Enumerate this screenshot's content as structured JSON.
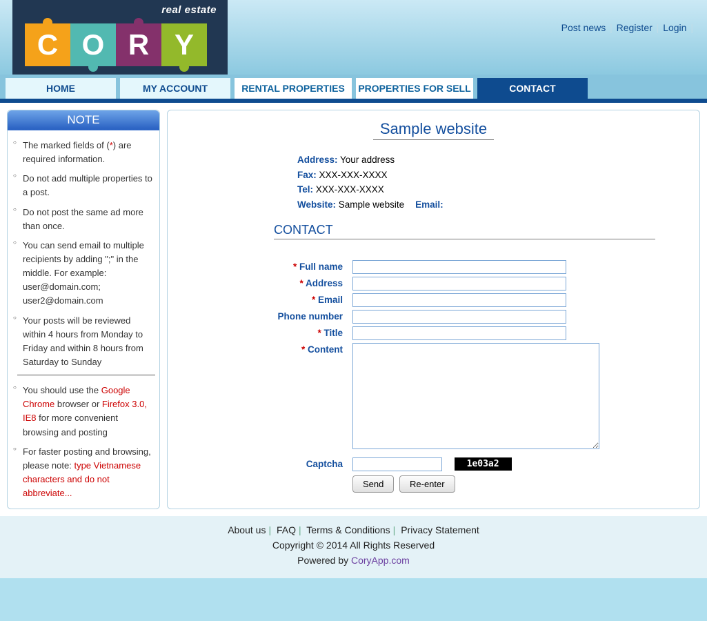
{
  "header": {
    "logo_top": "real estate",
    "logo_letters": [
      "C",
      "O",
      "R",
      "Y"
    ],
    "links": {
      "post": "Post news",
      "register": "Register",
      "login": "Login"
    }
  },
  "nav": {
    "items": [
      "HOME",
      "MY ACCOUNT",
      "RENTAL PROPERTIES",
      "PROPERTIES FOR SELL",
      "CONTACT"
    ]
  },
  "sidebar": {
    "title": "NOTE",
    "items": [
      {
        "pre": "The marked fields of (",
        "red": "*",
        "post": ") are required information."
      },
      {
        "text": "Do not add multiple properties to a post."
      },
      {
        "text": "Do not post the same ad more than once."
      },
      {
        "text": "You can send email to multiple recipients by adding \";\" in the middle. For example: user@domain.com; user2@domain.com"
      },
      {
        "text": "Your posts will be reviewed within 4 hours from Monday to Friday and within 8 hours from Saturday to Sunday"
      },
      {
        "pre": "You should use the ",
        "red": "Google Chrome",
        "mid": " browser or ",
        "red2": "Firefox 3.0, IE8",
        "post": " for more convenient browsing and posting"
      },
      {
        "pre": "For faster posting and browsing, please note: ",
        "red": "type Vietnamese characters and do not abbreviate...",
        "post": ""
      }
    ]
  },
  "main": {
    "site_title": "Sample website",
    "info": {
      "address_label": "Address:",
      "address_val": "Your address",
      "fax_label": "Fax:",
      "fax_val": "XXX-XXX-XXXX",
      "tel_label": "Tel:",
      "tel_val": "XXX-XXX-XXXX",
      "website_label": "Website:",
      "website_val": "Sample website",
      "email_label": "Email:"
    },
    "section": "CONTACT",
    "form": {
      "fullname": "Full name",
      "address": "Address",
      "email": "Email",
      "phone": "Phone number",
      "title": "Title",
      "content": "Content",
      "captcha_label": "Captcha",
      "captcha_code": "1e03a2",
      "send": "Send",
      "reenter": "Re-enter"
    }
  },
  "footer": {
    "links": [
      "About us",
      "FAQ",
      "Terms & Conditions",
      "Privacy Statement"
    ],
    "copyright": "Copyright © 2014 All Rights Reserved",
    "powered_pre": "Powered by ",
    "powered_link": "CoryApp.com"
  }
}
